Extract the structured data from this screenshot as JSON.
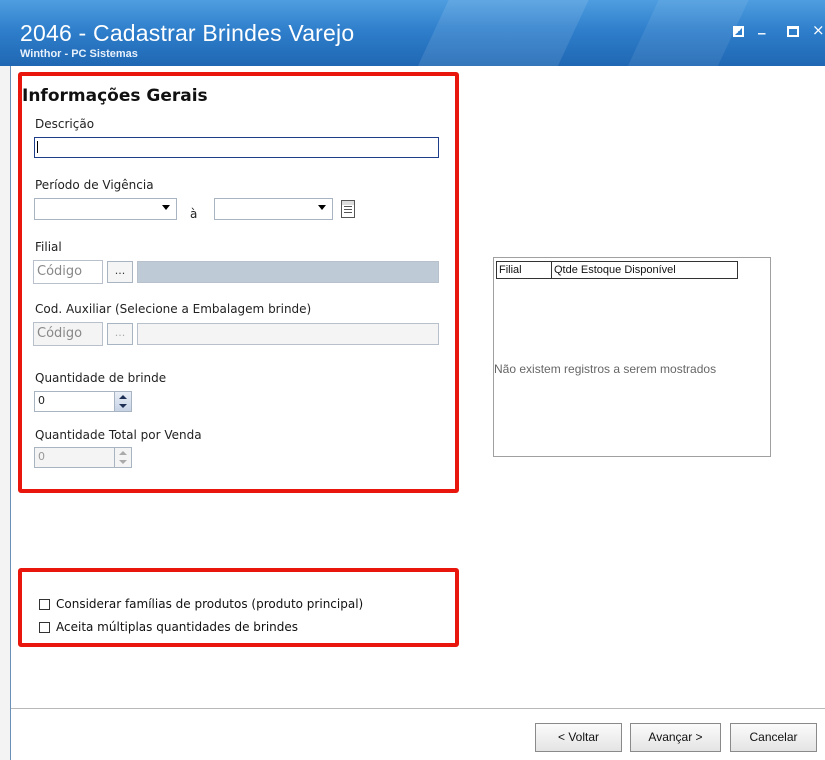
{
  "window": {
    "title": "2046 - Cadastrar Brindes Varejo",
    "subtitle": "Winthor - PC Sistemas",
    "minimize_glyph": "_",
    "close_glyph": "×"
  },
  "form": {
    "section_title": "Informações Gerais",
    "descricao_label": "Descrição",
    "descricao_value": "",
    "periodo_label": "Período de Vigência",
    "periodo_sep": "à",
    "periodo_start": "",
    "periodo_end": "",
    "filial_label": "Filial",
    "filial_code_placeholder": "Código",
    "filial_lookup": "...",
    "cod_aux_label": "Cod. Auxiliar (Selecione a Embalagem brinde)",
    "cod_aux_code_placeholder": "Código",
    "cod_aux_lookup": "...",
    "qtd_brinde_label": "Quantidade de brinde",
    "qtd_brinde_value": "0",
    "qtd_total_label": "Quantidade Total por Venda",
    "qtd_total_value": "0"
  },
  "grid": {
    "columns": [
      "Filial",
      "Qtde Estoque Disponível"
    ],
    "empty_message": "Não existem registros a serem mostrados"
  },
  "options": {
    "consider_families": "Considerar famílias de produtos (produto principal)",
    "multiple_quantities": "Aceita múltiplas quantidades de brindes"
  },
  "buttons": {
    "back": "< Voltar",
    "next": "Avançar >",
    "cancel": "Cancelar"
  },
  "colors": {
    "titlebar": "#2f7fcc",
    "highlight": "#e8160c",
    "disabled_field": "#bfcad7"
  }
}
